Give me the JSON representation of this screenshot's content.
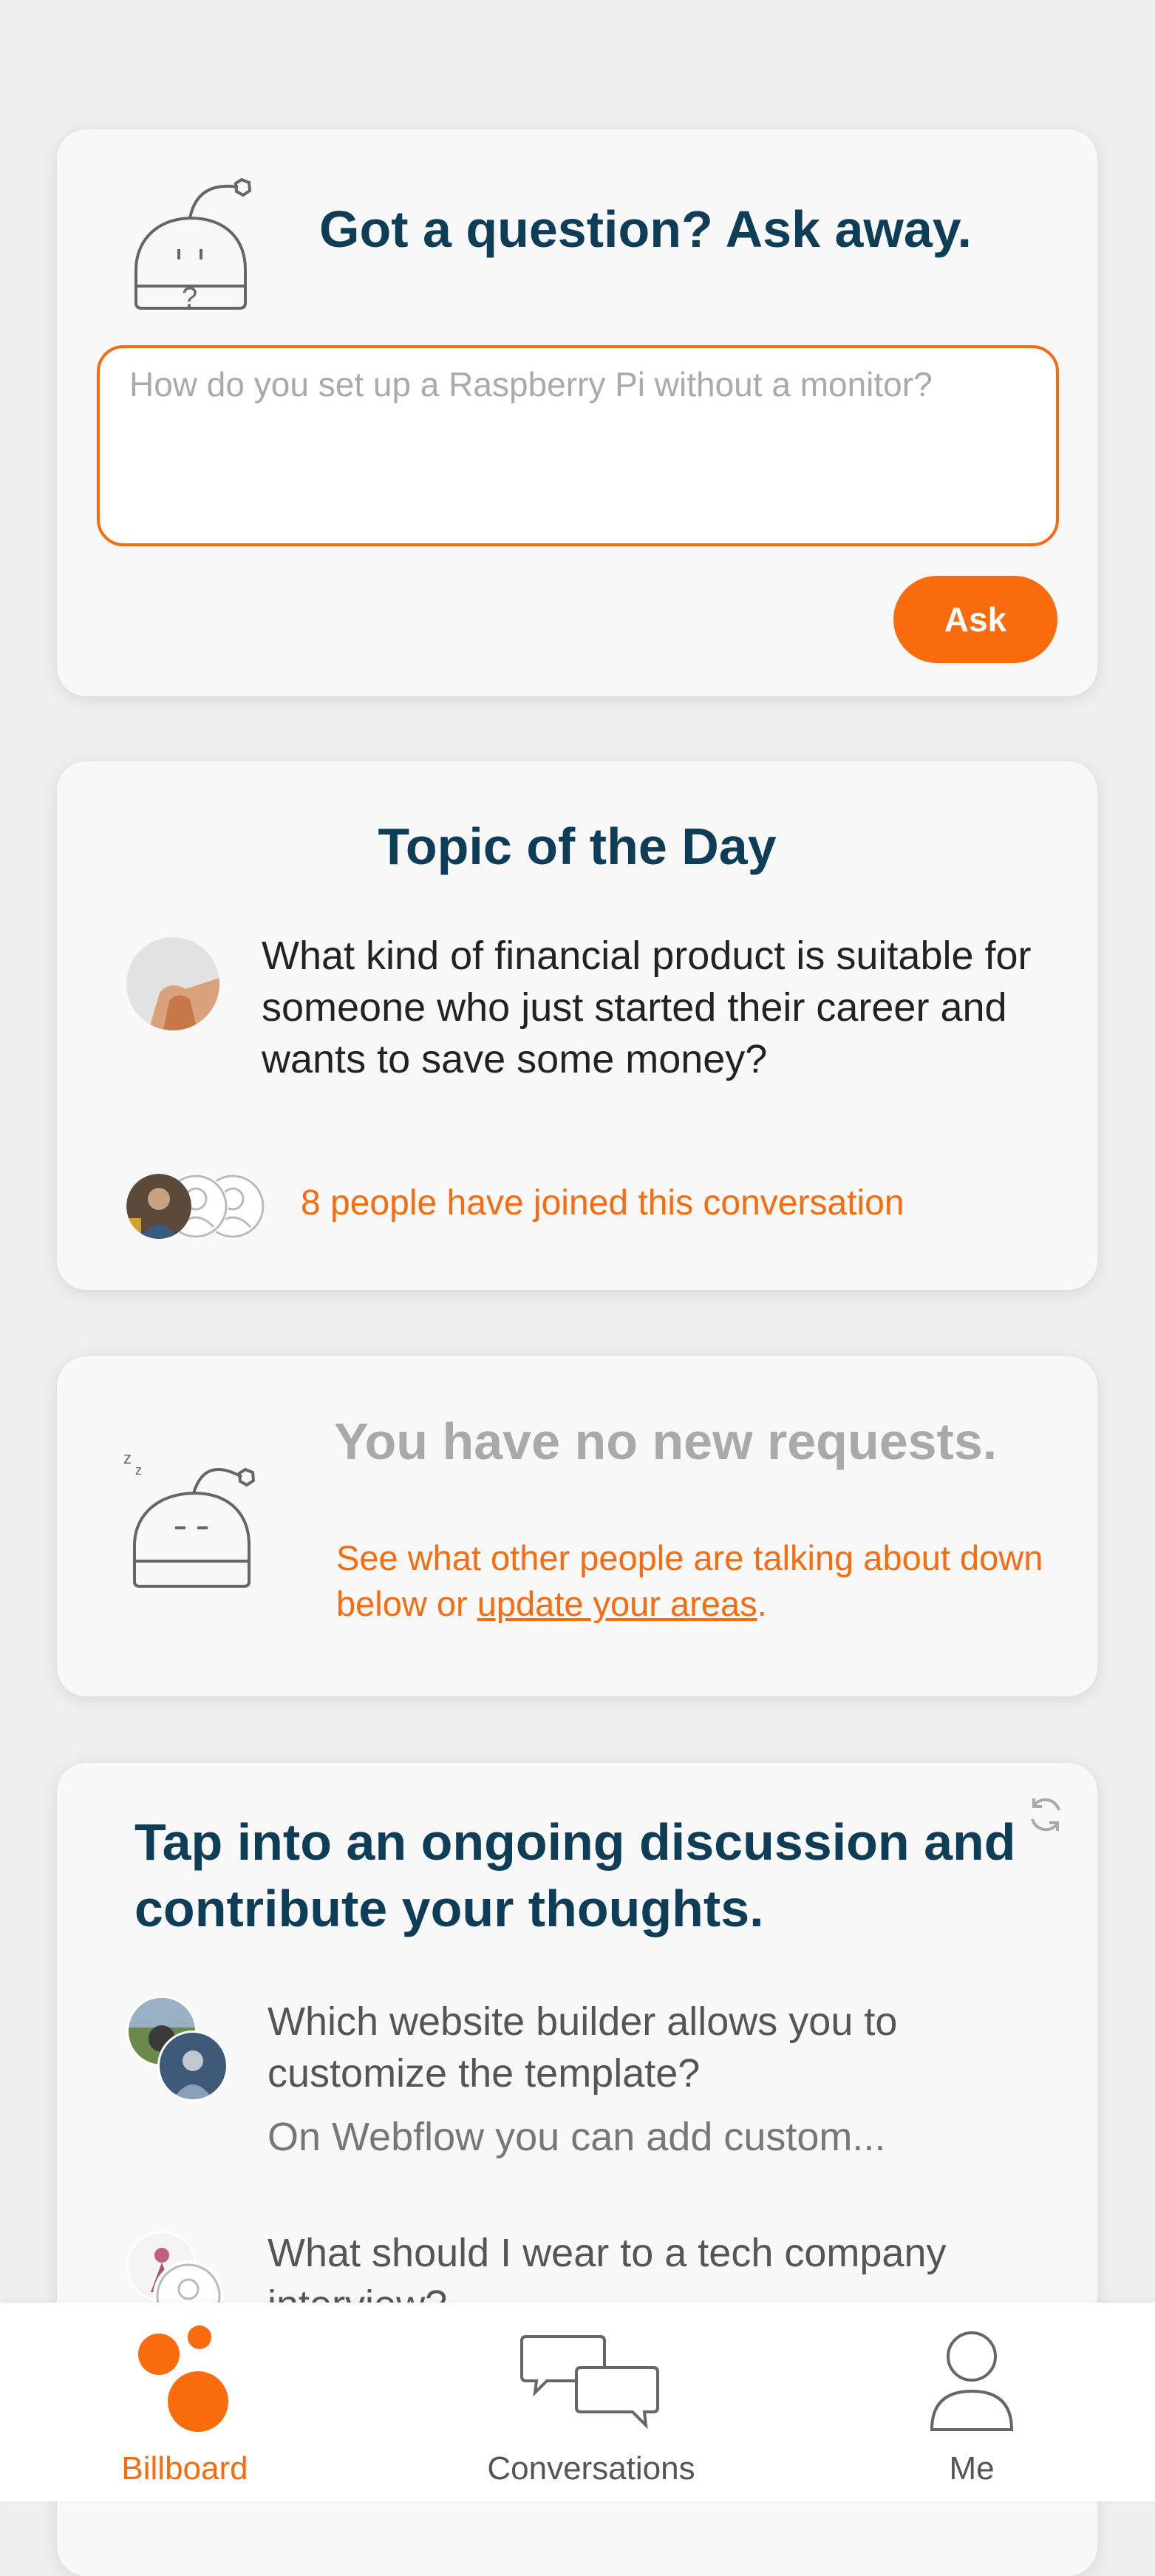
{
  "ask": {
    "title": "Got a question? Ask away.",
    "placeholder": "How do you set up a Raspberry Pi without a monitor?",
    "button_label": "Ask"
  },
  "topic": {
    "title": "Topic of the Day",
    "question": "What kind of financial product is suitable for someone who just started their career and wants to save some money?",
    "joined_text": "8 people have joined this conversation"
  },
  "requests": {
    "title": "You have no new requests.",
    "subtitle_prefix": "See what other people are talking about down below or ",
    "link_text": "update your areas",
    "subtitle_suffix": "."
  },
  "discussion": {
    "title": "Tap into an ongoing discussion and contribute your thoughts.",
    "items": [
      {
        "question": "Which website builder allows you to customize the template?",
        "answer_preview": "On Webflow you  can add custom..."
      },
      {
        "question": "What should I wear to a tech company interview?",
        "answer_preview": ""
      }
    ]
  },
  "nav": {
    "items": [
      {
        "label": "Billboard",
        "icon": "billboard-icon",
        "active": true
      },
      {
        "label": "Conversations",
        "icon": "conversations-icon",
        "active": false
      },
      {
        "label": "Me",
        "icon": "profile-icon",
        "active": false
      }
    ]
  },
  "colors": {
    "accent": "#f96b0d",
    "heading": "#0e3d58",
    "card": "#f8f8f8",
    "background": "#efefef",
    "muted": "#a9a9a9"
  }
}
